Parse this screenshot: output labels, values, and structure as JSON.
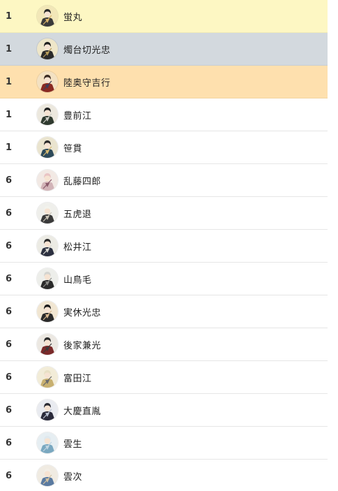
{
  "ranking": {
    "rows": [
      {
        "rank": "1",
        "name": "蛍丸",
        "tier": "gold",
        "portrait": {
          "bg": "#f2e7b8",
          "hair": "#2a2a2a",
          "coat": "#3a3a3a",
          "accent": "#d9b46a"
        }
      },
      {
        "rank": "1",
        "name": "燭台切光忠",
        "tier": "silver",
        "portrait": {
          "bg": "#eee6c9",
          "hair": "#1f1f1f",
          "coat": "#2b2b2b",
          "accent": "#b49a5a"
        }
      },
      {
        "rank": "1",
        "name": "陸奥守吉行",
        "tier": "bronze",
        "portrait": {
          "bg": "#f3e1c2",
          "hair": "#3a2a22",
          "coat": "#8a2a22",
          "accent": "#3c3c5a"
        }
      },
      {
        "rank": "1",
        "name": "豊前江",
        "tier": "plain",
        "portrait": {
          "bg": "#ece8de",
          "hair": "#1f1f1f",
          "coat": "#2f3a2f",
          "accent": "#c8c8c0"
        }
      },
      {
        "rank": "1",
        "name": "笹貫",
        "tier": "plain",
        "portrait": {
          "bg": "#eae4cf",
          "hair": "#2a2a2a",
          "coat": "#2d4a5a",
          "accent": "#d4b872"
        }
      },
      {
        "rank": "6",
        "name": "乱藤四郎",
        "tier": "plain",
        "portrait": {
          "bg": "#f2e9e4",
          "hair": "#e9c4c4",
          "coat": "#d2b4b8",
          "accent": "#8a5a6a"
        }
      },
      {
        "rank": "6",
        "name": "五虎退",
        "tier": "plain",
        "portrait": {
          "bg": "#efefeb",
          "hair": "#f2f2ec",
          "coat": "#3a3a3a",
          "accent": "#c8c2b4"
        }
      },
      {
        "rank": "6",
        "name": "松井江",
        "tier": "plain",
        "portrait": {
          "bg": "#ecebe4",
          "hair": "#2a2a2a",
          "coat": "#2c3040",
          "accent": "#d6d6d0"
        }
      },
      {
        "rank": "6",
        "name": "山鳥毛",
        "tier": "plain",
        "portrait": {
          "bg": "#edeeea",
          "hair": "#d4d4d0",
          "coat": "#2a2a2a",
          "accent": "#8a8a86"
        }
      },
      {
        "rank": "6",
        "name": "実休光忠",
        "tier": "plain",
        "portrait": {
          "bg": "#f1e6d2",
          "hair": "#1a1a1a",
          "coat": "#2a2a2a",
          "accent": "#d8b890"
        }
      },
      {
        "rank": "6",
        "name": "後家兼光",
        "tier": "plain",
        "portrait": {
          "bg": "#ece8e2",
          "hair": "#2a2a2a",
          "coat": "#7a2a2a",
          "accent": "#3a3a3a"
        }
      },
      {
        "rank": "6",
        "name": "富田江",
        "tier": "plain",
        "portrait": {
          "bg": "#f2ecd8",
          "hair": "#e8e0c4",
          "coat": "#c8b070",
          "accent": "#6a6a6a"
        }
      },
      {
        "rank": "6",
        "name": "大慶直胤",
        "tier": "plain",
        "portrait": {
          "bg": "#e9ebf0",
          "hair": "#2a2a32",
          "coat": "#2a2a3a",
          "accent": "#b8c0d0"
        }
      },
      {
        "rank": "6",
        "name": "雲生",
        "tier": "plain",
        "portrait": {
          "bg": "#e6eef2",
          "hair": "#dfe8ee",
          "coat": "#7aa8c0",
          "accent": "#c0d4e0"
        }
      },
      {
        "rank": "6",
        "name": "雲次",
        "tier": "plain",
        "portrait": {
          "bg": "#f0ebe2",
          "hair": "#f2eee6",
          "coat": "#5a7aa0",
          "accent": "#d0c0a0"
        }
      }
    ]
  }
}
